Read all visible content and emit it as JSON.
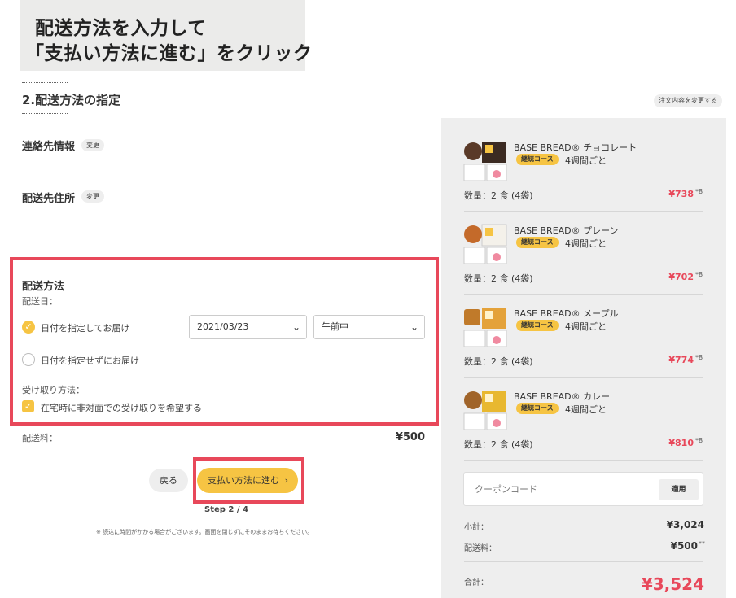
{
  "annotation": {
    "line1": "配送方法を入力して",
    "line2": "「支払い方法に進む」をクリック"
  },
  "step_title": "2.配送方法の指定",
  "change_order_label": "注文内容を変更する",
  "contact": {
    "label": "連絡先情報",
    "change_label": "変更"
  },
  "address": {
    "label": "配送先住所",
    "change_label": "変更"
  },
  "shipping": {
    "heading": "配送方法",
    "date_label": "配送日：",
    "option_specify": "日付を指定してお届け",
    "option_unspecified": "日付を指定せずにお届け",
    "date_value": "2021/03/23",
    "time_value": "午前中",
    "receive_label": "受け取り方法：",
    "receive_option": "在宅時に非対面での受け取りを希望する"
  },
  "fee": {
    "label": "配送料：",
    "value": "¥500"
  },
  "buttons": {
    "back": "戻る",
    "next": "支払い方法に進む",
    "next_arrow": "›"
  },
  "step_indicator": "Step 2 / 4",
  "notice": "※ 読込に時間がかかる場合がございます。画面を閉じずにそのままお待ちください。",
  "cart": {
    "items": [
      {
        "name": "BASE BREAD® チョコレート",
        "badge": "継続コース",
        "frequency": "4週間ごと",
        "quantity": "数量：2 食 (4袋)",
        "price": "¥738",
        "mark": "*8",
        "color": "#5a3a28"
      },
      {
        "name": "BASE BREAD® プレーン",
        "badge": "継続コース",
        "frequency": "4週間ごと",
        "quantity": "数量：2 食 (4袋)",
        "price": "¥702",
        "mark": "*8",
        "color": "#c46a2a"
      },
      {
        "name": "BASE BREAD® メープル",
        "badge": "継続コース",
        "frequency": "4週間ごと",
        "quantity": "数量：2 食 (4袋)",
        "price": "¥774",
        "mark": "*8",
        "color": "#d08a34"
      },
      {
        "name": "BASE BREAD® カレー",
        "badge": "継続コース",
        "frequency": "4週間ごと",
        "quantity": "数量：2 食 (4袋)",
        "price": "¥810",
        "mark": "*8",
        "color": "#a0642a"
      }
    ],
    "coupon_placeholder": "クーポンコード",
    "coupon_apply": "適用",
    "subtotal_label": "小計：",
    "subtotal_value": "¥3,024",
    "shipping_label": "配送料：",
    "shipping_value": "¥500",
    "shipping_mark": "**",
    "total_label": "合計：",
    "total_value": "¥3,524"
  },
  "colors": {
    "accent_yellow": "#f6c443",
    "highlight_red": "#e8485a",
    "price_red": "#e8485a",
    "panel_bg": "#eeeeee"
  }
}
